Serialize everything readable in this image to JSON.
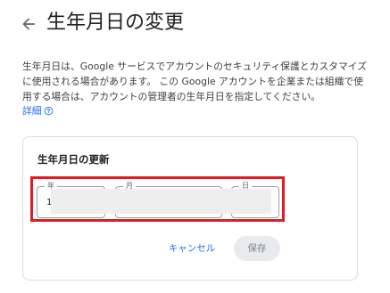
{
  "header": {
    "back_icon": "arrow-back-icon",
    "title": "生年月日の変更"
  },
  "description": {
    "text": "生年月日は、Google サービスでアカウントのセキュリティ保護とカスタマイズに使用される場合があります。 この Google アカウントを企業または組織で使用する場合は、アカウントの管理者の生年月日を指定してください。",
    "learn_more": "詳細",
    "learn_more_icon": "help-circle-icon"
  },
  "card": {
    "title": "生年月日の更新",
    "fields": {
      "year": {
        "label": "年",
        "value": "1"
      },
      "month": {
        "label": "月",
        "value": ""
      },
      "day": {
        "label": "日",
        "value": ""
      }
    },
    "cancel_label": "キャンセル",
    "save_label": "保存"
  },
  "colors": {
    "link": "#1a73e8",
    "highlight_border": "#e01b24",
    "disabled_button_bg": "#e8eaed"
  }
}
